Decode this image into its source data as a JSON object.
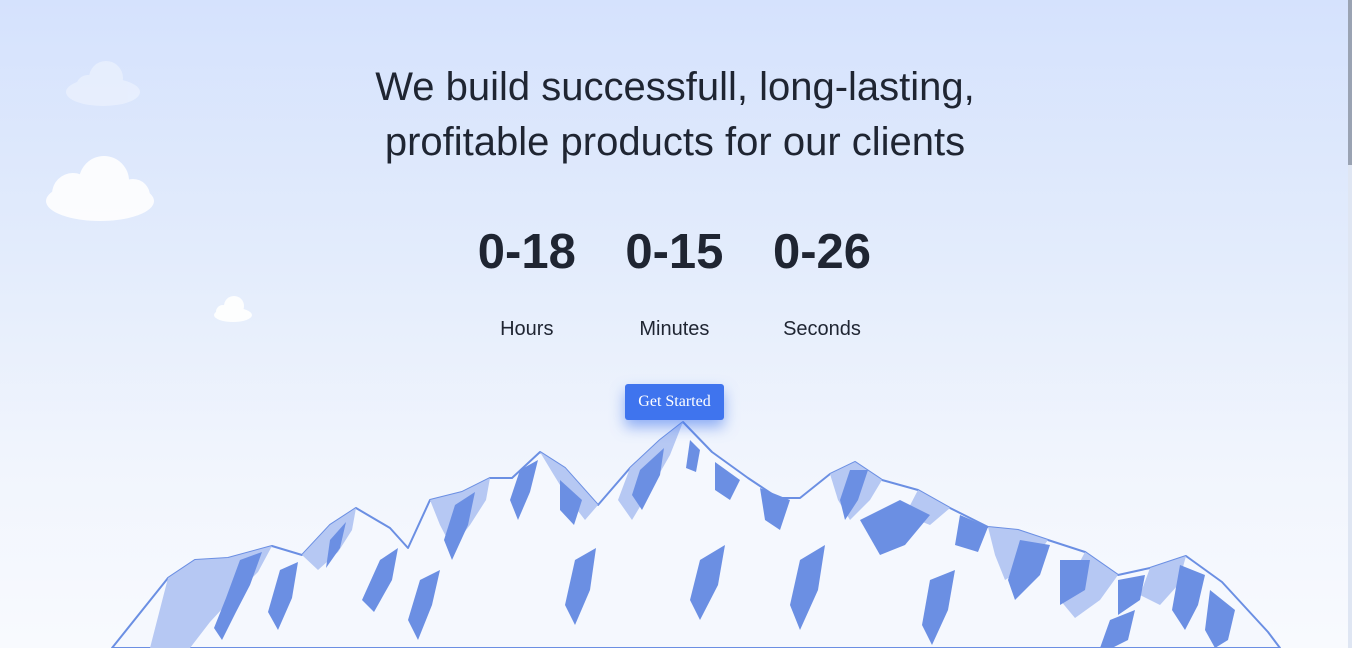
{
  "hero": {
    "headline_line1": "We build successfull, long-lasting,",
    "headline_line2": "profitable products for our clients",
    "cta_label": "Get Started"
  },
  "countdown": [
    {
      "value": "0-18",
      "label": "Hours"
    },
    {
      "value": "0-15",
      "label": "Minutes"
    },
    {
      "value": "0-26",
      "label": "Seconds"
    }
  ],
  "colors": {
    "sky_top": "#d5e2fd",
    "sky_bottom": "#f8fafe",
    "text": "#1f2532",
    "accent": "#3f74ee",
    "mountain_dark": "#6b8fe3",
    "mountain_light": "#b6c8f3",
    "snow": "#f5f8fe"
  },
  "icons": [
    "cloud-icon",
    "mountains-illustration"
  ]
}
